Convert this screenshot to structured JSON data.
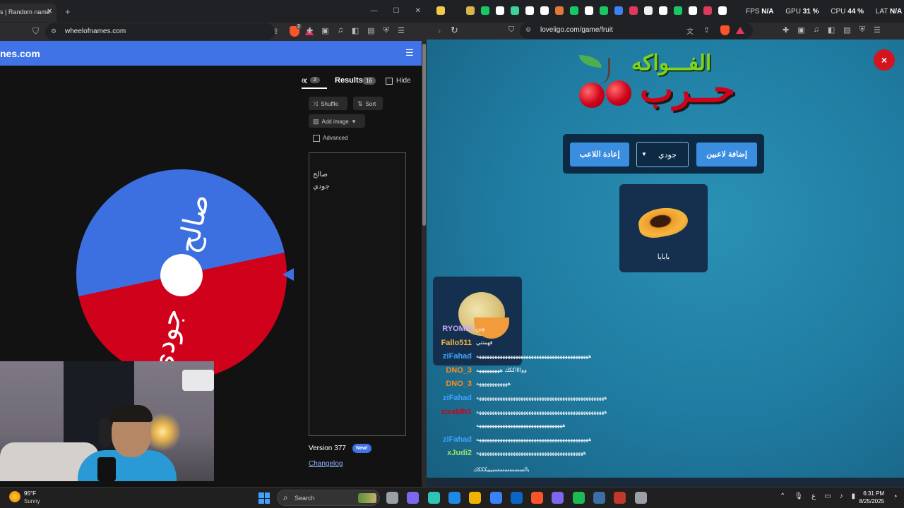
{
  "left_browser": {
    "tab_title": "s | Random name",
    "tab_close": "✕",
    "new_tab": "+",
    "window_controls": [
      "—",
      "☐",
      "✕"
    ],
    "url": "wheelofnames.com",
    "brave_badge": "2",
    "site_header": "nes.com",
    "menu_icon": "☰"
  },
  "wheel": {
    "segments": [
      {
        "label": "صالح",
        "color": "#3c6fe0"
      },
      {
        "label": "جودي",
        "color": "#d0021b"
      }
    ]
  },
  "panel": {
    "entries_tab_label": "e",
    "entries_count": "2",
    "results_label": "Results",
    "results_count": "16",
    "hide_label": "Hide",
    "shuffle_label": "Shuffle",
    "sort_label": "Sort",
    "add_image_label": "Add image",
    "advanced_label": "Advanced",
    "entries": [
      "صالح",
      "جودي"
    ],
    "version_label": "Version 377",
    "new_badge": "New!",
    "changelog_label": "Changelog"
  },
  "right_browser": {
    "stats": {
      "fps_label": "FPS",
      "fps": "N/A",
      "gpu_label": "GPU",
      "gpu": "31 %",
      "cpu_label": "CPU",
      "cpu": "44 %",
      "lat_label": "LAT",
      "lat": "N/A"
    },
    "url": "loveligo.com/game/fruit",
    "extension_colors": [
      "#f2c94c",
      "#222",
      "#d9b64c",
      "#17c964",
      "#fff",
      "#3ed39a",
      "#fff",
      "#fff",
      "#e07a3a",
      "#17c964",
      "#fff",
      "#17c964",
      "#3b82f6",
      "#e0395c",
      "#f1f1f1",
      "#fff",
      "#17c964",
      "#fff",
      "#e0395c",
      "#fff"
    ]
  },
  "game": {
    "logo_top": "الفـــواكه",
    "logo_main": "حــرب",
    "close_label": "×",
    "reset_button": "إعادة اللاعب",
    "selected_player": "جودي",
    "add_players_button": "إضافة لاعبين",
    "main_card_label": "بابايا"
  },
  "chat": [
    {
      "user": "RYOMM",
      "color": "#c9a6ff",
      "msg": "وين"
    },
    {
      "user": "Fallo511",
      "color": "#f5b73f",
      "msg": "فهمتني"
    },
    {
      "user": "ziFahad",
      "color": "#3ba3ff",
      "msg": "هههههههههههههههههههههههههههههههههههههههههههه"
    },
    {
      "user": "DNO_3",
      "color": "#ff8c1a",
      "msg": "ووااااككك هههههههههه"
    },
    {
      "user": "DNO_3",
      "color": "#ff8c1a",
      "msg": "ههههههههههههه"
    },
    {
      "user": "ziFahad",
      "color": "#3ba3ff",
      "msg": "هههههههههههههههههههههههههههههههههههههههههههههههههه"
    },
    {
      "user": "zixaldh1",
      "color": "#d0021b",
      "msg": "هههههههههههههههههههههههههههههههههههههههههههههههههه"
    },
    {
      "user": "",
      "color": "#fff",
      "msg": "هههههههههههههههههههههههههههههههههه"
    },
    {
      "user": "ziFahad",
      "color": "#3ba3ff",
      "msg": "هههههههههههههههههههههههههههههههههههههههههههه"
    },
    {
      "user": "xJudi2",
      "color": "#9be06b",
      "msg": "هههههههههههههههههههههههههههههههههههههههههه"
    }
  ],
  "chat_bottom": "بالسسسسسسبيييكككك",
  "taskbar": {
    "temperature": "95°F",
    "condition": "Sunny",
    "search_placeholder": "Search",
    "app_colors": [
      "#9aa0a6",
      "#7b68ee",
      "#2ec4b6",
      "#1e88e5",
      "#f0b400",
      "#3b82f6",
      "#0a66c2",
      "#fb542b",
      "#7b68ee",
      "#1db954",
      "#3a6ea5",
      "#c0392b",
      "#9aa0a6"
    ],
    "tray_lang": "ع",
    "time": "6:31 PM",
    "date": "8/25/2025"
  }
}
